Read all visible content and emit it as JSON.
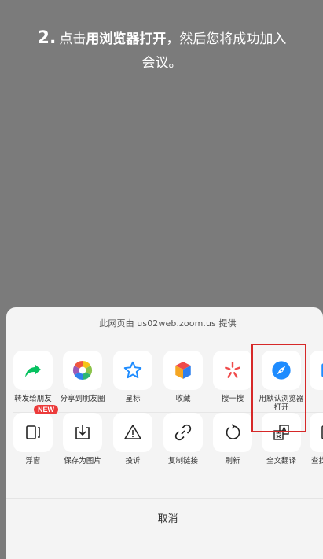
{
  "instruction": {
    "number": "2.",
    "prefix": "点击",
    "bold": "用浏览器打开",
    "suffix": "，然后您将成功加入会议。"
  },
  "sheet": {
    "provider": "此网页由 us02web.zoom.us 提供",
    "row1": [
      {
        "name": "share-friend",
        "label": "转发给朋友",
        "icon": "share-arrow-icon"
      },
      {
        "name": "share-moments",
        "label": "分享到朋友圈",
        "icon": "moments-icon"
      },
      {
        "name": "star",
        "label": "星标",
        "icon": "star-icon"
      },
      {
        "name": "favorite",
        "label": "收藏",
        "icon": "cube-icon"
      },
      {
        "name": "search",
        "label": "搜一搜",
        "icon": "search-spark-icon"
      },
      {
        "name": "open-browser",
        "label": "用默认浏览器打开",
        "icon": "compass-icon"
      }
    ],
    "row2": [
      {
        "name": "float-window",
        "label": "浮窗",
        "icon": "float-window-icon",
        "badge": "NEW"
      },
      {
        "name": "save-image",
        "label": "保存为图片",
        "icon": "download-icon"
      },
      {
        "name": "report",
        "label": "投诉",
        "icon": "warning-icon"
      },
      {
        "name": "copy-link",
        "label": "复制链接",
        "icon": "link-icon"
      },
      {
        "name": "refresh",
        "label": "刷新",
        "icon": "refresh-icon"
      },
      {
        "name": "translate",
        "label": "全文翻译",
        "icon": "translate-icon"
      },
      {
        "name": "find",
        "label": "查找",
        "icon": "find-icon"
      }
    ],
    "cancel": "取消"
  },
  "colors": {
    "overlay": "#7b7b7b",
    "sheet": "#f4f4f4",
    "share_green": "#07c160",
    "star_blue": "#1e8cff",
    "compass_blue": "#1e8cff",
    "search_red": "#f04b4b",
    "highlight": "#d62828"
  }
}
